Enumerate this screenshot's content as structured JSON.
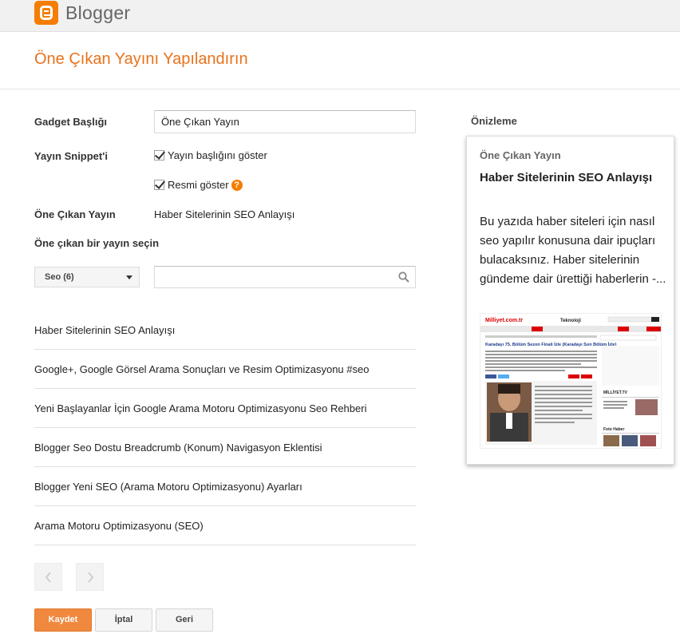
{
  "app": {
    "name": "Blogger"
  },
  "page": {
    "title": "Öne Çıkan Yayını Yapılandırın"
  },
  "form": {
    "gadget_title_label": "Gadget Başlığı",
    "gadget_title_value": "Öne Çıkan Yayın",
    "snippet_label": "Yayın Snippet'i",
    "show_post_title_label": "Yayın başlığını göster",
    "show_post_title_checked": true,
    "show_image_label": "Resmi göster",
    "show_image_checked": true,
    "help_glyph": "?",
    "featured_post_label": "Öne Çıkan Yayın",
    "featured_post_value": "Haber Sitelerinin SEO Anlayışı",
    "choose_post_label": "Öne çıkan bir yayın seçin",
    "label_filter_value": "Seo (6)",
    "search_placeholder": ""
  },
  "posts": [
    {
      "title": "Haber Sitelerinin SEO Anlayışı"
    },
    {
      "title": "Google+, Google Görsel Arama Sonuçları ve Resim Optimizasyonu #seo"
    },
    {
      "title": "Yeni Başlayanlar İçin Google Arama Motoru Optimizasyonu Seo Rehberi"
    },
    {
      "title": "Blogger Seo Dostu Breadcrumb (Konum) Navigasyon Eklentisi"
    },
    {
      "title": "Blogger Yeni SEO (Arama Motoru Optimizasyonu) Ayarları"
    },
    {
      "title": "Arama Motoru Optimizasyonu (SEO)"
    }
  ],
  "buttons": {
    "save": "Kaydet",
    "cancel": "İptal",
    "back": "Geri"
  },
  "preview": {
    "label": "Önizleme",
    "gadget_title": "Öne Çıkan Yayın",
    "post_title": "Haber Sitelerinin SEO Anlayışı",
    "snippet": "Bu yazıda haber siteleri için nasıl seo yapılır konusuna dair ipuçları bulacaksınız. Haber sitelerinin gündeme dair ürettiği haberlerin -...",
    "thumb": {
      "site": "Milliyet.com.tr",
      "section": "Teknoloji",
      "headline": "Karadayı 75. Bölüm Sezon Finali İzle (Karadayı Son Bölüm İzle)",
      "side_title": "MİLLİYET.TV",
      "side_title_2": "Foto Haber"
    }
  },
  "colors": {
    "accent": "#f57d00",
    "title": "#e8721c",
    "save_button": "#f0883e"
  },
  "icons": {
    "logo": "blogger-logo-icon",
    "search": "search-icon",
    "prev": "chevron-left-icon",
    "next": "chevron-right-icon",
    "help": "help-icon",
    "check": "checkmark-icon"
  }
}
